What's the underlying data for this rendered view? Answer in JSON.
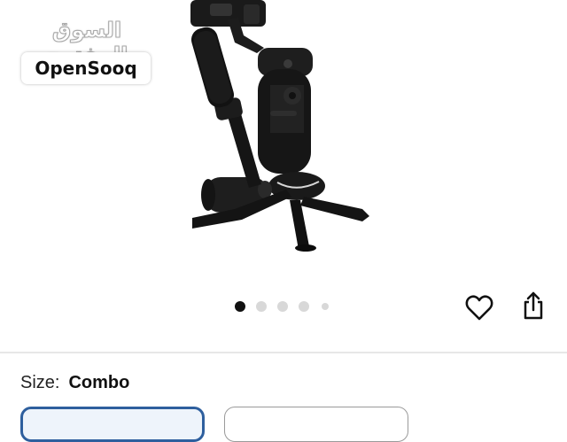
{
  "watermark": {
    "arabic": "السوق المفتوح",
    "brand": "OpenSooq"
  },
  "gallery": {
    "image_subject": "gimbal-stabilizer",
    "dot_count": 5,
    "active_dot": 1
  },
  "actions": {
    "favorite_icon": "heart-icon",
    "share_icon": "share-icon"
  },
  "size_selector": {
    "label": "Size:",
    "selected": "Combo"
  },
  "colors": {
    "selected_border": "#2e5f9e",
    "active_dot": "#111111",
    "inactive_dot": "#d8d8d8"
  }
}
